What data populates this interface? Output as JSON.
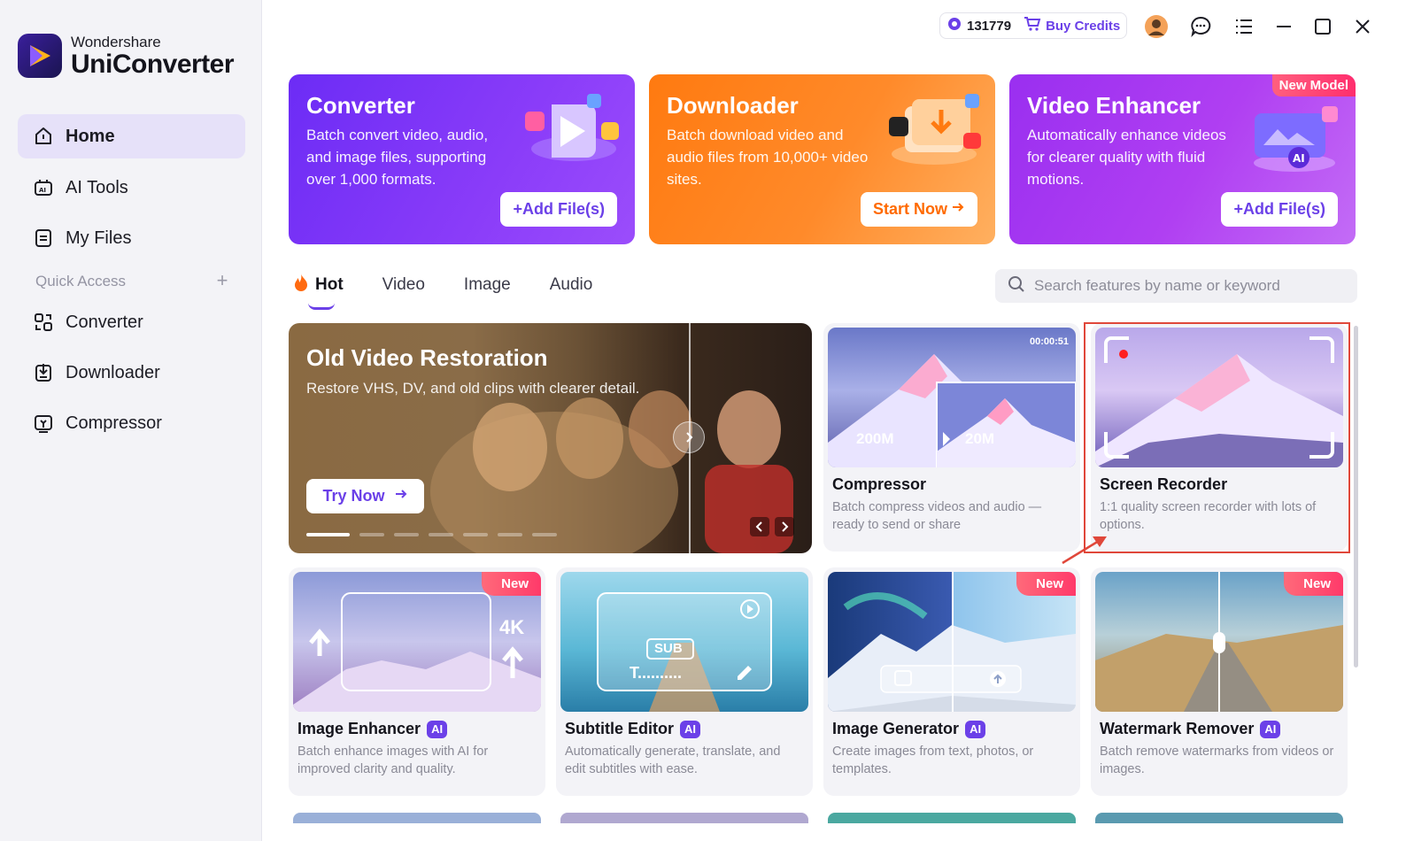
{
  "brand": {
    "line1": "Wondershare",
    "line2": "UniConverter"
  },
  "nav": [
    {
      "label": "Home",
      "icon": "home-icon",
      "active": true
    },
    {
      "label": "AI Tools",
      "icon": "ai-tools-icon"
    },
    {
      "label": "My Files",
      "icon": "my-files-icon"
    }
  ],
  "quick_access": {
    "label": "Quick Access",
    "items": [
      {
        "label": "Converter",
        "icon": "converter-icon"
      },
      {
        "label": "Downloader",
        "icon": "downloader-icon"
      },
      {
        "label": "Compressor",
        "icon": "compressor-icon"
      }
    ]
  },
  "topbar": {
    "credits": "131779",
    "buy_label": "Buy Credits"
  },
  "hero": [
    {
      "title": "Converter",
      "desc": "Batch convert video, audio, and image files, supporting over 1,000 formats.",
      "button": "+Add File(s)",
      "color": "#7b2ff7"
    },
    {
      "title": "Downloader",
      "desc": "Batch download video and audio files from 10,000+ video sites.",
      "button": "Start Now",
      "color": "#ff7a1a"
    },
    {
      "title": "Video Enhancer",
      "desc": "Automatically enhance videos for clearer quality with fluid motions.",
      "button": "+Add File(s)",
      "badge": "New Model",
      "color": "#a12ff0"
    }
  ],
  "tabs": [
    "Hot",
    "Video",
    "Image",
    "Audio"
  ],
  "search": {
    "placeholder": "Search features by name or keyword"
  },
  "banner": {
    "title": "Old Video Restoration",
    "desc": "Restore VHS, DV, and old clips with clearer detail.",
    "button": "Try Now"
  },
  "cards": {
    "compressor": {
      "title": "Compressor",
      "desc": "Batch compress videos and audio — ready to send or share",
      "timer": "00:00:51",
      "from": "200M",
      "to": "20M"
    },
    "screen_recorder": {
      "title": "Screen Recorder",
      "desc": "1:1 quality screen recorder with lots of options."
    },
    "image_enhancer": {
      "title": "Image Enhancer",
      "desc": "Batch enhance images with AI for improved clarity and quality.",
      "badge": "New",
      "ai": "AI",
      "res": "4K"
    },
    "subtitle_editor": {
      "title": "Subtitle Editor",
      "desc": "Automatically generate, translate, and edit subtitles with ease.",
      "ai": "AI",
      "sub": "SUB",
      "text": "T.........."
    },
    "image_generator": {
      "title": "Image Generator",
      "desc": "Create images from text, photos, or templates.",
      "badge": "New",
      "ai": "AI"
    },
    "watermark_remover": {
      "title": "Watermark Remover",
      "desc": "Batch remove watermarks from videos or images.",
      "badge": "New",
      "ai": "AI"
    }
  },
  "colors": {
    "accent": "#6b40e8",
    "highlight": "#e0473a"
  }
}
